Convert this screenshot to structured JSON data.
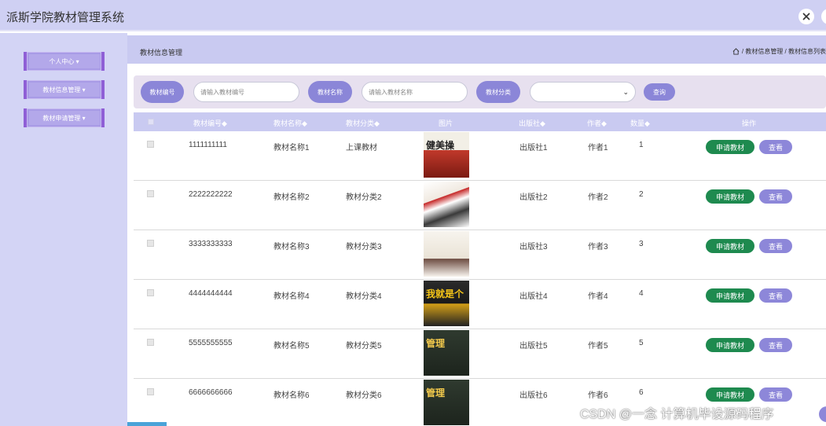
{
  "header": {
    "app_title": "派斯学院教材管理系统",
    "close_icon": "close-x-icon"
  },
  "sidebar": {
    "items": [
      {
        "label": "个人中心 ▾"
      },
      {
        "label": "教材信息管理 ▾"
      },
      {
        "label": "教材申请管理 ▾"
      }
    ]
  },
  "breadcrumb": {
    "page_title": "教材信息管理",
    "path": "/ 教材信息管理 / 教材信息列表",
    "home_icon": "home-icon"
  },
  "search": {
    "code_label": "教材编号",
    "code_placeholder": "请输入教材编号",
    "name_label": "教材名称",
    "name_placeholder": "请输入教材名称",
    "category_label": "教材分类",
    "category_value": "",
    "query_label": "查询"
  },
  "table": {
    "headers": {
      "code": "教材编号◆",
      "name": "教材名称◆",
      "category": "教材分类◆",
      "image": "图片",
      "publisher": "出版社◆",
      "author": "作者◆",
      "quantity": "数量◆",
      "actions": "操作"
    },
    "apply_label": "申请教材",
    "view_label": "查看",
    "rows": [
      {
        "code": "1111111111",
        "name": "教材名称1",
        "category": "上课教材",
        "publisher": "出版社1",
        "author": "作者1",
        "quantity": "1",
        "cover_text": "健美操"
      },
      {
        "code": "2222222222",
        "name": "教材名称2",
        "category": "教材分类2",
        "publisher": "出版社2",
        "author": "作者2",
        "quantity": "2",
        "cover_text": ""
      },
      {
        "code": "3333333333",
        "name": "教材名称3",
        "category": "教材分类3",
        "publisher": "出版社3",
        "author": "作者3",
        "quantity": "3",
        "cover_text": ""
      },
      {
        "code": "4444444444",
        "name": "教材名称4",
        "category": "教材分类4",
        "publisher": "出版社4",
        "author": "作者4",
        "quantity": "4",
        "cover_text": "我就是个"
      },
      {
        "code": "5555555555",
        "name": "教材名称5",
        "category": "教材分类5",
        "publisher": "出版社5",
        "author": "作者5",
        "quantity": "5",
        "cover_text": "管理"
      },
      {
        "code": "6666666666",
        "name": "教材名称6",
        "category": "教材分类6",
        "publisher": "出版社6",
        "author": "作者6",
        "quantity": "6",
        "cover_text": "管理"
      }
    ]
  },
  "watermark": "CSDN @一念 计算机毕设源码程序",
  "colors": {
    "header_bg": "#cfd0f3",
    "accent": "#8b86d8",
    "apply_green": "#1e8a4f"
  }
}
